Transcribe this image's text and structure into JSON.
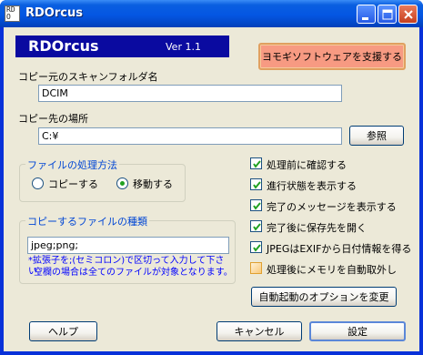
{
  "window": {
    "icon_text": [
      "RD",
      "O"
    ],
    "title": "RDOrcus"
  },
  "banner": {
    "app_name": "RDOrcus",
    "version": "Ver 1.1"
  },
  "support_button": "ヨモギソフトウェアを支援する",
  "source_folder": {
    "label": "コピー元のスキャンフォルダ名",
    "value": "DCIM"
  },
  "destination": {
    "label": "コピー先の場所",
    "value": "C:¥",
    "browse_label": "参照"
  },
  "file_handling": {
    "title": "ファイルの処理方法",
    "options": [
      {
        "label": "コピーする",
        "selected": false
      },
      {
        "label": "移動する",
        "selected": true
      }
    ]
  },
  "file_types": {
    "title": "コピーするファイルの種類",
    "value": "jpeg;png;",
    "hint_line1": "*拡張子を;(セミコロン)で区切って入力して下さい。",
    "hint_line2": "空欄の場合は全てのファイルが対象となります。"
  },
  "options": [
    {
      "label": "処理前に確認する",
      "checked": true
    },
    {
      "label": "進行状態を表示する",
      "checked": true
    },
    {
      "label": "完了のメッセージを表示する",
      "checked": true
    },
    {
      "label": "完了後に保存先を開く",
      "checked": true
    },
    {
      "label": "JPEGはEXIFから日付情報を得る",
      "checked": true
    },
    {
      "label": "処理後にメモリを自動取外し",
      "checked": false
    }
  ],
  "autostart_button": "自動起動のオプションを変更",
  "footer": {
    "help": "ヘルプ",
    "cancel": "キャンセル",
    "ok": "設定"
  },
  "colors": {
    "titlebar": "#0456e3",
    "banner": "#0a0aa0",
    "support_button": "#f79a82",
    "group_title": "#0046d5",
    "hint_text": "#0000ff"
  }
}
